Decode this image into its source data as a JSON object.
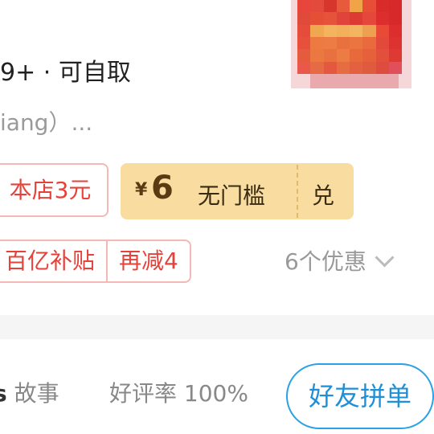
{
  "shop": {
    "meta": "9+ · 可自取",
    "address": "iang）..."
  },
  "promotions": {
    "store_tag": "本店3元",
    "coupon": {
      "currency": "¥",
      "amount": "6",
      "condition": "无门槛",
      "redeem_label": "兑"
    },
    "subsidy_tags": [
      "百亿补贴",
      "再减4"
    ],
    "offers_label": "6个优惠"
  },
  "tabs": {
    "partial_char": "s",
    "story": "故事",
    "rating": "好评率 100%"
  },
  "actions": {
    "group_buy": "好友拼单"
  },
  "colors": {
    "coupon_bg": "#f8dca0",
    "red_accent": "#e5423a",
    "blue_accent": "#1d90d8"
  }
}
